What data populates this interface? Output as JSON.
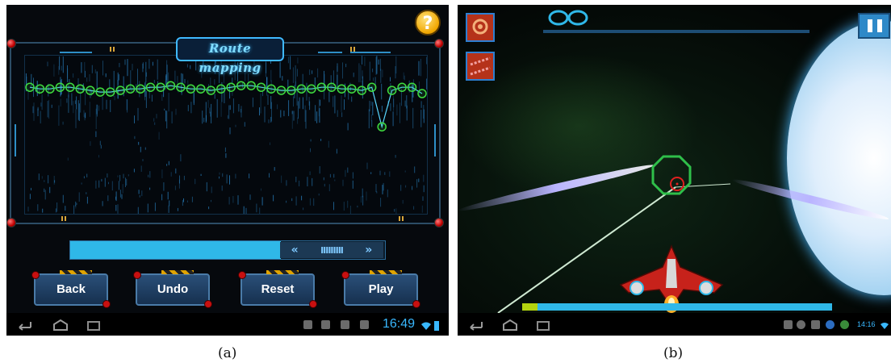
{
  "left_screen": {
    "title": "Route mapping",
    "help_label": "?",
    "slider_arrow_left": "«",
    "slider_arrow_right": "»",
    "slider_grip": "IIIIIIIII",
    "slider_progress": 0.67,
    "buttons": {
      "back": "Back",
      "undo": "Undo",
      "reset": "Reset",
      "play": "Play"
    },
    "status_time": "16:49",
    "caption": "(a)",
    "route_y": [
      0.2,
      0.21,
      0.21,
      0.2,
      0.2,
      0.21,
      0.22,
      0.23,
      0.23,
      0.22,
      0.21,
      0.21,
      0.2,
      0.2,
      0.19,
      0.2,
      0.21,
      0.21,
      0.22,
      0.21,
      0.2,
      0.19,
      0.19,
      0.2,
      0.21,
      0.22,
      0.22,
      0.21,
      0.21,
      0.2,
      0.2,
      0.21,
      0.21,
      0.22,
      0.2,
      0.45,
      0.22,
      0.2,
      0.2,
      0.24
    ]
  },
  "right_screen": {
    "health_fill": 0.05,
    "status_time": "14:16",
    "caption": "(b)"
  }
}
